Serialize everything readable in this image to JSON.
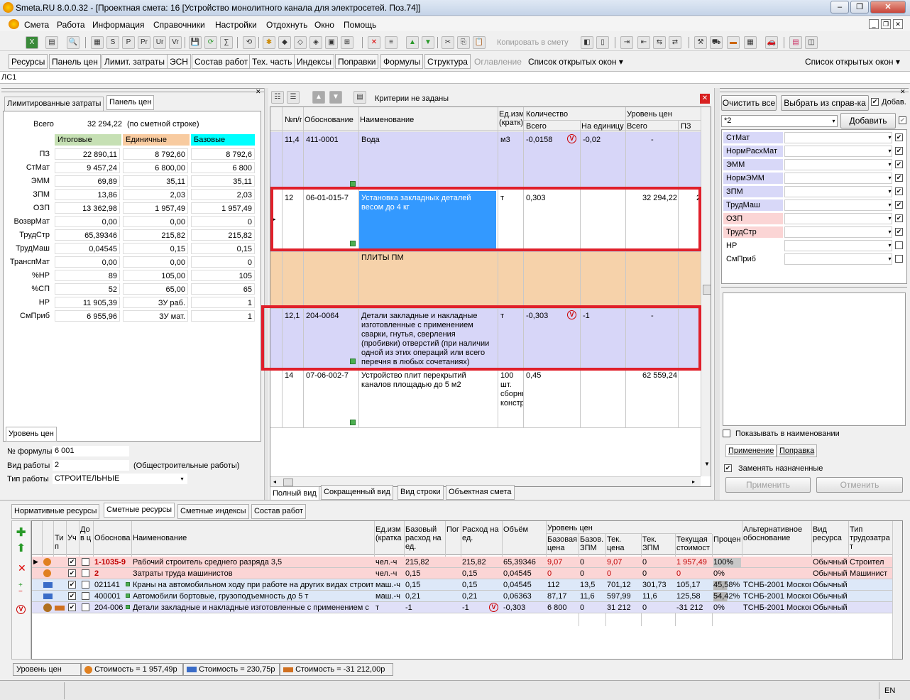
{
  "app": {
    "title": "Smeta.RU  8.0.0.32  - [Проектная смета: 16 [Устройство монолитного канала для электросетей. Поз.74]]"
  },
  "menu": [
    "Смета",
    "Работа",
    "Информация",
    "Справочники",
    "Настройки",
    "Отдохнуть",
    "Окно",
    "Помощь"
  ],
  "toolbar": {
    "copy_label": "Копировать в смету"
  },
  "tabs": [
    "Ресурсы",
    "Панель цен",
    "Лимит. затраты",
    "ЭСН",
    "Состав работ",
    "Тех. часть",
    "Индексы",
    "Поправки",
    "Формулы",
    "Структура",
    "Оглавление",
    "Список открытых окон ▾"
  ],
  "tabs_right": "Список открытых окон ▾",
  "breadcrumb": "ЛС1",
  "left": {
    "tabs": [
      "Лимитированные затраты",
      "Панель цен"
    ],
    "total_label": "Всего",
    "total_value": "32 294,22",
    "total_note": "(по сметной строке)",
    "col_headers": [
      "Итоговые",
      "Единичные",
      "Базовые"
    ],
    "col_colors": [
      "#c6e0b4",
      "#f8cba0",
      "#00ffff"
    ],
    "rows": [
      [
        "ПЗ",
        "22 890,11",
        "8 792,60",
        "8 792,6"
      ],
      [
        "СтМат",
        "9 457,24",
        "6 800,00",
        "6 800"
      ],
      [
        "ЭММ",
        "69,89",
        "35,11",
        "35,11"
      ],
      [
        "ЗПМ",
        "13,86",
        "2,03",
        "2,03"
      ],
      [
        "ОЗП",
        "13 362,98",
        "1 957,49",
        "1 957,49"
      ],
      [
        "ВозврМат",
        "0,00",
        "0,00",
        "0"
      ],
      [
        "ТрудСтр",
        "65,39346",
        "215,82",
        "215,82"
      ],
      [
        "ТрудМаш",
        "0,04545",
        "0,15",
        "0,15"
      ],
      [
        "ТранспМат",
        "0,00",
        "0,00",
        "0"
      ],
      [
        "%НР",
        "89",
        "105,00",
        "105"
      ],
      [
        "%СП",
        "52",
        "65,00",
        "65"
      ],
      [
        "НР",
        "11 905,39",
        "ЗУ раб.",
        "1"
      ],
      [
        "СмПриб",
        "6 955,96",
        "ЗУ мат.",
        "1"
      ]
    ],
    "bottom_tab": "Уровень цен",
    "formula_label": "№ формулы",
    "formula_value": "6 001",
    "worktype_label": "Вид работы",
    "worktype_value": "2",
    "worktype_note": "(Общестроительные работы)",
    "worktype2_label": "Тип работы",
    "worktype2_value": "СТРОИТЕЛЬНЫЕ"
  },
  "center": {
    "criteria": "Критерии не заданы",
    "headers": {
      "num": "№п/п",
      "basis": "Обоснование",
      "name": "Наименование",
      "unit": "Ед.изм.(кратк)",
      "qty": "Количество",
      "qty_total": "Всего",
      "qty_unit": "На единицу",
      "price": "Уровень цен",
      "price_total": "Всего",
      "price_pz": "ПЗ"
    },
    "rows": [
      {
        "num": "11,4",
        "basis": "411-0001",
        "name": "Вода",
        "unit": "м3",
        "total": "-0,0158",
        "per": "-0,02",
        "price": "-"
      },
      {
        "num": "12",
        "basis": "06-01-015-7",
        "name": "Установка закладных деталей весом до 4 кг",
        "unit": "т",
        "total": "0,303",
        "per": "",
        "price": "32 294,22",
        "pz": "2"
      },
      {
        "num": "",
        "basis": "",
        "name": "ПЛИТЫ ПМ",
        "unit": "",
        "total": "",
        "per": "",
        "price": ""
      },
      {
        "num": "12,1",
        "basis": "204-0064",
        "name": "Детали закладные и накладные изготовленные с применением сварки, гнутья, сверления (пробивки) отверстий (при наличии одной из этих операций или всего перечня в любых сочетаниях)",
        "unit": "т",
        "total": "-0,303",
        "per": "-1",
        "price": "-"
      },
      {
        "num": "14",
        "basis": "07-06-002-7",
        "name": "Устройство плит перекрытий каналов площадью до 5 м2",
        "unit": "100 шт. сборны констр",
        "total": "0,45",
        "per": "",
        "price": "62 559,24"
      }
    ],
    "bottom_tabs": [
      "Полный вид",
      "Сокращенный вид",
      "Вид строки",
      "Объектная смета"
    ]
  },
  "right": {
    "btn_clear": "Очистить все",
    "btn_select": "Выбрать из справ-ка",
    "chk_add": "Добав.",
    "input_value": "*2",
    "btn_add": "Добавить",
    "items": [
      {
        "label": "СтМат",
        "bg": "#d8d8f8",
        "checked": true
      },
      {
        "label": "НормРасхМат",
        "bg": "#d8d8f8",
        "checked": true
      },
      {
        "label": "ЭММ",
        "bg": "#d8d8f8",
        "checked": true
      },
      {
        "label": "НормЭММ",
        "bg": "#d8d8f8",
        "checked": true
      },
      {
        "label": "ЗПМ",
        "bg": "#d8d8f8",
        "checked": true
      },
      {
        "label": "ТрудМаш",
        "bg": "#d8d8f8",
        "checked": true
      },
      {
        "label": "ОЗП",
        "bg": "#fbd5d5",
        "checked": true
      },
      {
        "label": "ТрудСтр",
        "bg": "#fbd5d5",
        "checked": true
      },
      {
        "label": "НР",
        "bg": "#ffffff",
        "checked": false
      },
      {
        "label": "СмПриб",
        "bg": "#ffffff",
        "checked": false
      }
    ],
    "show_in_name": "Показывать в наименовании",
    "tabs": [
      "Применение",
      "Поправка"
    ],
    "replace": "Заменять назначенные",
    "btn_apply": "Применить",
    "btn_cancel": "Отменить"
  },
  "bottom": {
    "tabs": [
      "Нормативные ресурсы",
      "Сметные ресурсы",
      "Сметные индексы",
      "Состав работ"
    ],
    "headers": {
      "type": "Тип",
      "uch": "Уч",
      "do": "До в ц",
      "basis": "Обоснова",
      "name": "Наименование",
      "unit": "Ед.изм (кратка",
      "baserate": "Базовый расход на ед.",
      "por": "Пог",
      "rate": "Расход на ед.",
      "vol": "Объём",
      "level": "Уровень цен",
      "bprice": "Базовая цена",
      "bzpm": "Базов. ЗПМ",
      "tprice": "Тек. цена",
      "tzpm": "Тек. ЗПМ",
      "tcost": "Текущая стоимост",
      "pct": "Процен",
      "alt": "Альтернативное обоснование",
      "vres": "Вид ресурса",
      "ttype": "Тип трудозатрат"
    },
    "rows": [
      {
        "basis": "1-1035-9",
        "name": "Рабочий строитель среднего разряда 3,5",
        "unit": "чел.-ч",
        "baserate": "215,82",
        "rate": "215,82",
        "vol": "65,39346",
        "bprice": "9,07",
        "bzpm": "0",
        "tprice": "9,07",
        "tzpm": "0",
        "tcost": "1 957,49",
        "pct": "100%",
        "alt": "",
        "vres": "Обычный",
        "ttype": "Строител",
        "bg": "#fbd5d5",
        "red": true
      },
      {
        "basis": "2",
        "name": "Затраты труда машинистов",
        "unit": "чел.-ч",
        "baserate": "0,15",
        "rate": "0,15",
        "vol": "0,04545",
        "bprice": "0",
        "bzpm": "0",
        "tprice": "0",
        "tzpm": "0",
        "tcost": "0",
        "pct": "0%",
        "alt": "",
        "vres": "Обычный",
        "ttype": "Машинист",
        "bg": "#fbd5d5",
        "red": true
      },
      {
        "basis": "021141",
        "name": "Краны на автомобильном ходу при работе на других видах строит",
        "unit": "маш.-ч",
        "baserate": "0,15",
        "rate": "0,15",
        "vol": "0,04545",
        "bprice": "112",
        "bzpm": "13,5",
        "tprice": "701,12",
        "tzpm": "301,73",
        "tcost": "105,17",
        "pct": "45,58%",
        "alt": "ТСНБ-2001 Москов",
        "vres": "Обычный",
        "ttype": "",
        "bg": "#dde8f8",
        "red": false
      },
      {
        "basis": "400001",
        "name": "Автомобили бортовые, грузоподъемность до 5 т",
        "unit": "маш.-ч",
        "baserate": "0,21",
        "rate": "0,21",
        "vol": "0,06363",
        "bprice": "87,17",
        "bzpm": "11,6",
        "tprice": "597,99",
        "tzpm": "11,6",
        "tcost": "125,58",
        "pct": "54,42%",
        "alt": "ТСНБ-2001 Москов",
        "vres": "Обычный",
        "ttype": "",
        "bg": "#dde8f8",
        "red": false
      },
      {
        "basis": "204-006",
        "name": "Детали закладные и накладные изготовленные с применением с",
        "unit": "т",
        "baserate": "-1",
        "rate": "-1",
        "vol": "-0,303",
        "bprice": "6 800",
        "bzpm": "0",
        "tprice": "31 212",
        "tzpm": "0",
        "tcost": "-31 212",
        "pct": "0%",
        "alt": "ТСНБ-2001 Москов",
        "vres": "Обычный",
        "ttype": "",
        "bg": "#e0e0f8",
        "red": false
      }
    ]
  },
  "status": {
    "level": "Уровень цен",
    "cost1": "Стоимость = 1 957,49р",
    "cost2": "Стоимость = 230,75р",
    "cost3": "Стоимость = -31 212,00р",
    "lang": "EN"
  }
}
